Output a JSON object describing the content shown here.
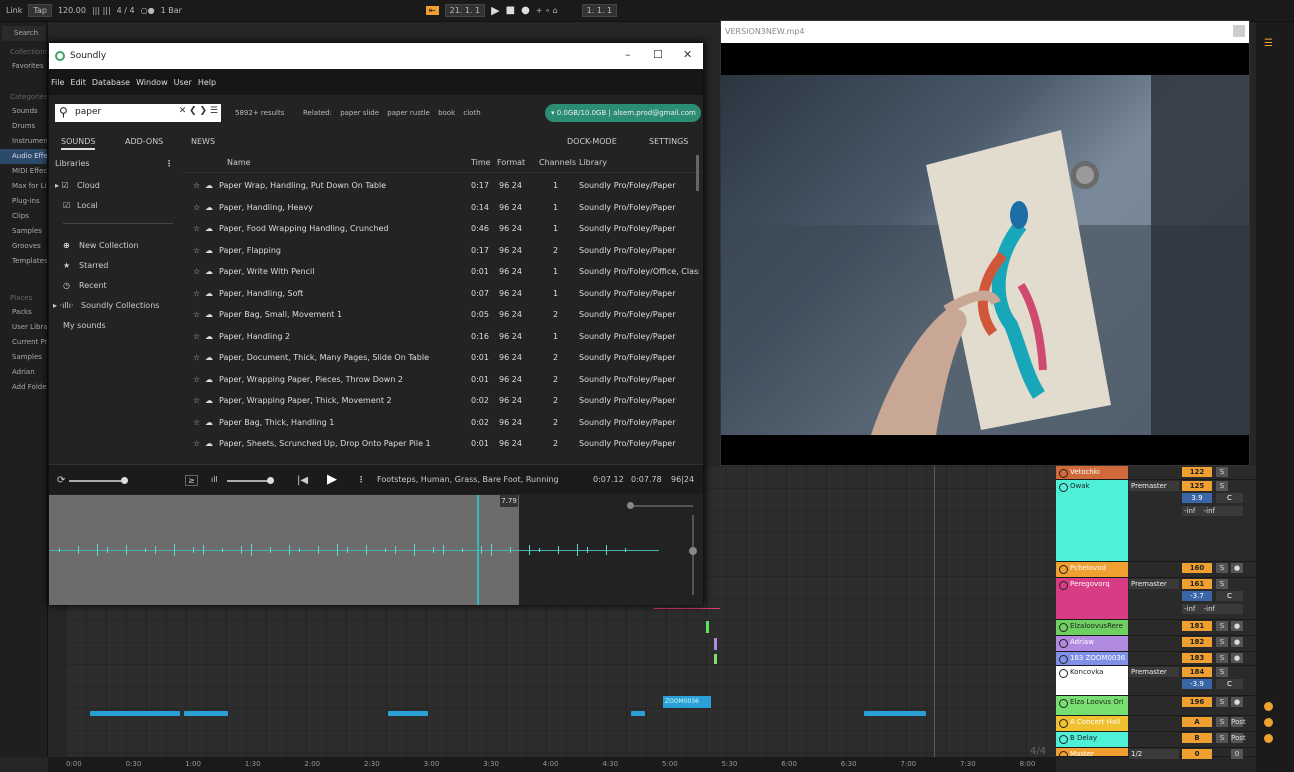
{
  "daw": {
    "transport": {
      "link": "Link",
      "tap": "Tap",
      "tempo": "120.00",
      "signature": "4 / 4",
      "quant": "1 Bar",
      "position": "21. 1. 1",
      "position2": "1. 1. 1"
    },
    "browser": {
      "search_label": "Search",
      "collections_header": "Collections",
      "favorites": "Favorites",
      "categories_header": "Categories",
      "categories": [
        "Sounds",
        "Drums",
        "Instruments",
        "Audio Effects",
        "MIDI Effects",
        "Max for Live",
        "Plug-ins",
        "Clips",
        "Samples",
        "Grooves",
        "Templates"
      ],
      "places_header": "Places",
      "places": [
        "Packs",
        "User Library",
        "Current Project",
        "Samples",
        "Adrian",
        "Add Folder"
      ]
    },
    "timeline": [
      "0:00",
      "0:30",
      "1:00",
      "1:30",
      "2:00",
      "2:30",
      "3:00",
      "3:30",
      "4:00",
      "4:30",
      "5:00",
      "5:30",
      "6:00",
      "6:30",
      "7:00",
      "7:30",
      "8:00"
    ],
    "clip_label": "ZOOM0036",
    "time_sig_marker": "4/4",
    "tracks": [
      {
        "name": "Vetochki",
        "color": "#d06a3a",
        "out": "",
        "num": "122",
        "s": "S",
        "r": "",
        "vol": "",
        "pan": "",
        "inf": ""
      },
      {
        "name": "Owak",
        "color": "#4ef0d8",
        "out": "Premaster",
        "num": "125",
        "s": "S",
        "r": "",
        "vol": "3.9",
        "pan": "C",
        "inf": "-inf -inf"
      },
      {
        "name": "Pchelovod",
        "color": "#f0a030",
        "out": "",
        "num": "160",
        "s": "S",
        "r": "●",
        "vol": "",
        "pan": "",
        "inf": ""
      },
      {
        "name": "Peregovorq",
        "color": "#d83c84",
        "out": "Premaster",
        "num": "161",
        "s": "S",
        "r": "",
        "vol": "-3.7",
        "pan": "C",
        "inf": "-inf -inf"
      },
      {
        "name": "ElzaloovusRere",
        "color": "#6ed060",
        "out": "",
        "num": "181",
        "s": "S",
        "r": "●",
        "vol": "",
        "pan": "",
        "inf": ""
      },
      {
        "name": "Adriaw",
        "color": "#b089e0",
        "out": "",
        "num": "182",
        "s": "S",
        "r": "●",
        "vol": "",
        "pan": "",
        "inf": ""
      },
      {
        "name": "183 ZOOM0036",
        "color": "#7f90e8",
        "out": "",
        "num": "183",
        "s": "S",
        "r": "●",
        "vol": "",
        "pan": "",
        "inf": ""
      },
      {
        "name": "Koncovka",
        "color": "#ffffff",
        "out": "Premaster",
        "num": "184",
        "s": "S",
        "r": "",
        "vol": "-3.9",
        "pan": "C",
        "inf": ""
      },
      {
        "name": "Elza Loovus Ori",
        "color": "#78e070",
        "out": "",
        "num": "196",
        "s": "S",
        "r": "●",
        "vol": "",
        "pan": "",
        "inf": ""
      },
      {
        "name": "A Concert Hall",
        "color": "#f0c030",
        "out": "",
        "num": "A",
        "s": "S",
        "r": "Post",
        "vol": "",
        "pan": "",
        "inf": ""
      },
      {
        "name": "B Delay",
        "color": "#4ef0d8",
        "out": "",
        "num": "B",
        "s": "S",
        "r": "Post",
        "vol": "",
        "pan": "",
        "inf": ""
      },
      {
        "name": "Master",
        "color": "#f0a030",
        "out": "1/2",
        "num": "0",
        "s": "",
        "r": "0",
        "vol": "",
        "pan": "",
        "inf": ""
      }
    ]
  },
  "soundly": {
    "title": "Soundly",
    "menu": [
      "File",
      "Edit",
      "Database",
      "Window",
      "User",
      "Help"
    ],
    "search": {
      "value": "paper",
      "controls": "✕ ❮ ❯ ☰"
    },
    "results_count": "5892+ results",
    "related_label": "Related:",
    "related": [
      "paper slide",
      "paper rustle",
      "book",
      "cloth"
    ],
    "account": "▾ 0.0GB/10.0GB | alsem.prod@gmail.com",
    "tabs": {
      "sounds": "SOUNDS",
      "addons": "ADD-ONS",
      "news": "NEWS",
      "dock": "DOCK-MODE",
      "settings": "SETTINGS"
    },
    "libraries_label": "Libraries",
    "cloud": "Cloud",
    "local": "Local",
    "new_collection": "New Collection",
    "starred": "Starred",
    "recent": "Recent",
    "soundly_collections": "Soundly Collections",
    "my_sounds": "My sounds",
    "columns": {
      "name": "Name",
      "time": "Time",
      "format": "Format",
      "channels": "Channels",
      "library": "Library"
    },
    "rows": [
      {
        "name": "Paper Wrap, Handling, Put Down On Table",
        "time": "0:17",
        "format": "96 24",
        "channels": "1",
        "library": "Soundly Pro/Foley/Paper"
      },
      {
        "name": "Paper, Handling, Heavy",
        "time": "0:14",
        "format": "96 24",
        "channels": "1",
        "library": "Soundly Pro/Foley/Paper"
      },
      {
        "name": "Paper, Food Wrapping Handling, Crunched",
        "time": "0:46",
        "format": "96 24",
        "channels": "1",
        "library": "Soundly Pro/Foley/Paper"
      },
      {
        "name": "Paper, Flapping",
        "time": "0:17",
        "format": "96 24",
        "channels": "2",
        "library": "Soundly Pro/Foley/Paper"
      },
      {
        "name": "Paper, Write With Pencil",
        "time": "0:01",
        "format": "96 24",
        "channels": "1",
        "library": "Soundly Pro/Foley/Office, Classro"
      },
      {
        "name": "Paper, Handling, Soft",
        "time": "0:07",
        "format": "96 24",
        "channels": "1",
        "library": "Soundly Pro/Foley/Paper"
      },
      {
        "name": "Paper Bag, Small, Movement 1",
        "time": "0:05",
        "format": "96 24",
        "channels": "2",
        "library": "Soundly Pro/Foley/Paper"
      },
      {
        "name": "Paper, Handling 2",
        "time": "0:16",
        "format": "96 24",
        "channels": "1",
        "library": "Soundly Pro/Foley/Paper"
      },
      {
        "name": "Paper, Document, Thick, Many Pages, Slide On Table",
        "time": "0:01",
        "format": "96 24",
        "channels": "2",
        "library": "Soundly Pro/Foley/Paper"
      },
      {
        "name": "Paper, Wrapping Paper, Pieces, Throw Down 2",
        "time": "0:01",
        "format": "96 24",
        "channels": "2",
        "library": "Soundly Pro/Foley/Paper"
      },
      {
        "name": "Paper, Wrapping Paper, Thick, Movement 2",
        "time": "0:02",
        "format": "96 24",
        "channels": "2",
        "library": "Soundly Pro/Foley/Paper"
      },
      {
        "name": "Paper Bag, Thick, Handling 1",
        "time": "0:02",
        "format": "96 24",
        "channels": "2",
        "library": "Soundly Pro/Foley/Paper"
      },
      {
        "name": "Paper, Sheets, Scrunched Up, Drop Onto Paper Pile 1",
        "time": "0:01",
        "format": "96 24",
        "channels": "2",
        "library": "Soundly Pro/Foley/Paper"
      }
    ],
    "player": {
      "now_playing": "Footsteps, Human, Grass, Bare Foot, Running",
      "pos": "0:07.12",
      "len": "0:07.78",
      "fmt": "96|24",
      "cursor_label": "7.79"
    }
  },
  "video": {
    "title": "VERSION3NEW.mp4"
  }
}
